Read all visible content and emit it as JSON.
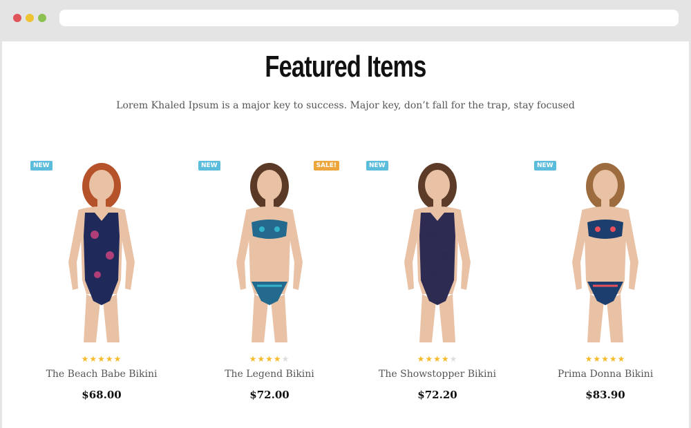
{
  "browser": {
    "dot_colors": [
      "#e0555a",
      "#efc234",
      "#8cc152"
    ]
  },
  "section": {
    "title": "Featured Items",
    "subtitle": "Lorem Khaled Ipsum is a major key to success. Major key, don’t fall for the trap, stay focused"
  },
  "colors": {
    "badge_new": "#5bbcdc",
    "badge_sale": "#eda63b",
    "star_filled": "#f6bb2a",
    "star_empty": "#dddddd"
  },
  "products": [
    {
      "name": "The Beach Babe Bikini",
      "price": "$68.00",
      "rating": 5,
      "badge_left": "NEW",
      "badge_right": "",
      "image": "woman-in-paisley-one-piece-swimsuit",
      "hair": "#b5522a",
      "suit": "#1f2a5a",
      "accent": "#d4437f"
    },
    {
      "name": "The Legend Bikini",
      "price": "$72.00",
      "rating": 4,
      "badge_left": "NEW",
      "badge_right": "SALE!",
      "image": "woman-in-teal-bandeau-bikini",
      "hair": "#5a3a26",
      "suit": "#236a8e",
      "accent": "#33b3c9"
    },
    {
      "name": "The Showstopper Bikini",
      "price": "$72.20",
      "rating": 4,
      "badge_left": "NEW",
      "badge_right": "",
      "image": "woman-in-navy-one-shoulder-swimsuit",
      "hair": "#5c3b28",
      "suit": "#2d2b52",
      "accent": "#2d2b52"
    },
    {
      "name": "Prima Donna Bikini",
      "price": "$83.90",
      "rating": 5,
      "badge_left": "NEW",
      "badge_right": "",
      "image": "woman-in-tropical-print-bikini",
      "hair": "#9c6c3f",
      "suit": "#1b3e6e",
      "accent": "#e8505b"
    }
  ]
}
